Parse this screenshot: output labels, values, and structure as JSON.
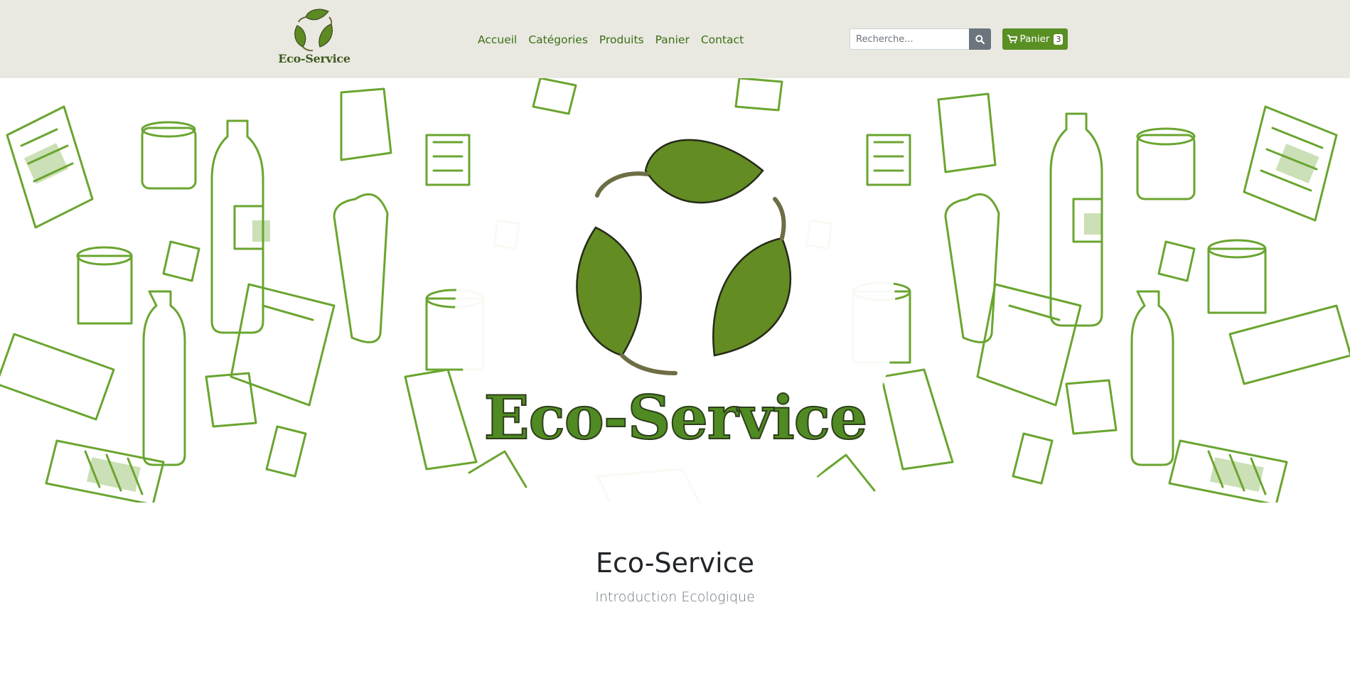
{
  "colors": {
    "header_bg": "#e9e9e1",
    "brand_green": "#5a8f23",
    "nav_link": "#3b6f16",
    "search_button": "#6c757d"
  },
  "brand": {
    "logo_icon": "recycle-leaves-icon",
    "name": "Eco-Service"
  },
  "nav": {
    "items": [
      {
        "label": "Accueil"
      },
      {
        "label": "Catégories"
      },
      {
        "label": "Produits"
      },
      {
        "label": "Panier"
      },
      {
        "label": "Contact"
      }
    ]
  },
  "search": {
    "placeholder": "Recherche...",
    "icon": "search-icon"
  },
  "cart": {
    "icon": "shopping-cart-icon",
    "label": "Panier",
    "count": "3"
  },
  "hero": {
    "logo_icon": "recycle-leaves-icon",
    "title": "Eco-Service"
  },
  "intro": {
    "title": "Eco-Service",
    "subtitle": "Introduction Ecologique"
  }
}
